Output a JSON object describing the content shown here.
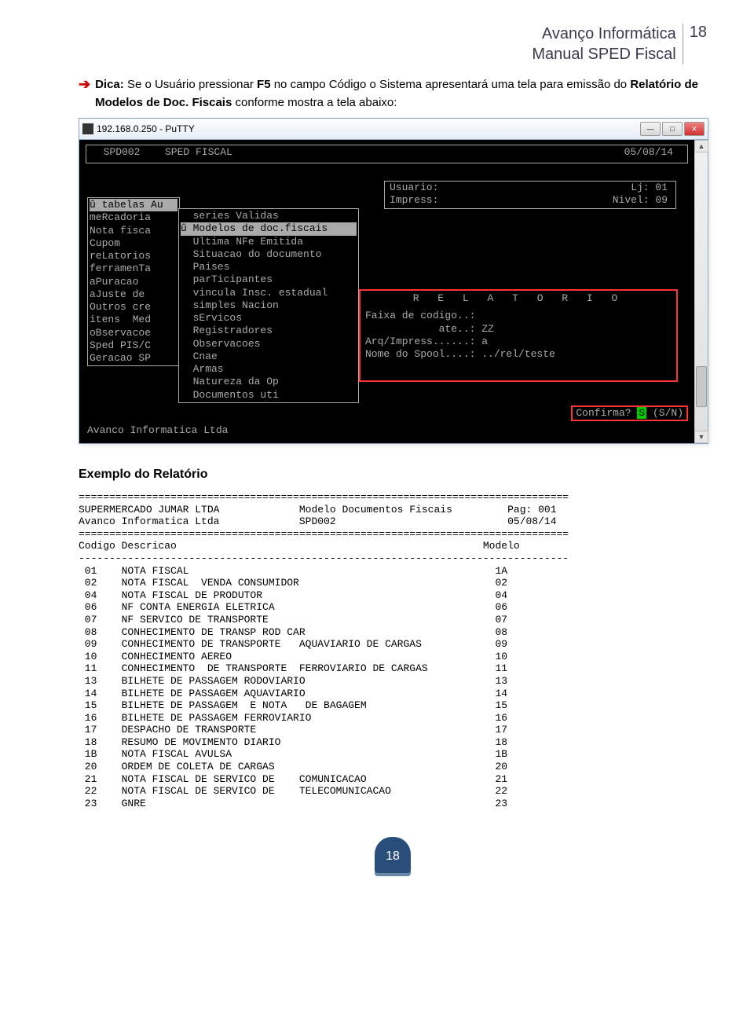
{
  "header": {
    "brand": "Avanço Informática",
    "manual": "Manual SPED Fiscal",
    "page": "18"
  },
  "dica": {
    "label": "Dica:",
    "text_before": " Se o Usuário pressionar ",
    "f5": "F5",
    "text_after": " no campo Código o Sistema apresentará uma tela para emissão do ",
    "bold2": "Relatório de Modelos de Doc. Fiscais",
    "text_end": " conforme mostra a tela abaixo:"
  },
  "putty": {
    "title": "192.168.0.250 - PuTTY",
    "btn_min": "—",
    "btn_max": "□",
    "btn_close": "✕"
  },
  "terminal": {
    "top": {
      "code": "SPD002",
      "title": "SPED FISCAL",
      "date": "05/08/14"
    },
    "userbox": {
      "l1a": "Usuario:",
      "l1b": "Lj: 01",
      "l2a": "Impress:",
      "l2b": "Nivel: 09"
    },
    "menu1": [
      "û tabelas Au",
      "meRcadoria",
      "Nota fisca",
      "Cupom",
      "reLatorios",
      "ferramenTa",
      "aPuracao",
      "aJuste de",
      "Outros cre",
      "itens  Med",
      "oBservacoe",
      "Sped PIS/C",
      "Geracao SP"
    ],
    "menu1_hl_index": 0,
    "menu2": [
      "  series Validas",
      "û Modelos de doc.fiscais",
      "  Ultima NFe Emitida",
      "  Situacao do documento",
      "  Paises",
      "  parTicipantes",
      "  vincula Insc. estadual",
      "  simples Nacion",
      "  sErvicos",
      "  Registradores",
      "  Observacoes",
      "  Cnae",
      "  Armas",
      "  Natureza da Op",
      "  Documentos uti"
    ],
    "menu2_hl_index": 1,
    "relatorio": {
      "title": "R E L A T O R I O",
      "lines": [
        "Faixa de codigo..:",
        "            ate..: ZZ",
        "Arq/Impress......: a",
        "Nome do Spool....: ../rel/teste"
      ]
    },
    "confirm": {
      "label": "Confirma? ",
      "val": "S",
      "opts": " (S/N)"
    },
    "footer": "Avanco Informatica Ltda"
  },
  "example_title": "Exemplo do Relatório",
  "report": {
    "sep": "================================================================================",
    "h1l": "SUPERMERCADO JUMAR LTDA",
    "h1m": "Modelo Documentos Fiscais",
    "h1r": "Pag: 001",
    "h2l": "Avanco Informatica Ltda",
    "h2m": "SPD002",
    "h2r": "05/08/14",
    "colhead_l": "Codigo Descricao",
    "colhead_r": "Modelo",
    "dash": "--------------------------------------------------------------------------------",
    "rows": [
      {
        "c": "01",
        "d": "NOTA FISCAL",
        "m": "1A"
      },
      {
        "c": "02",
        "d": "NOTA FISCAL  VENDA CONSUMIDOR",
        "m": "02"
      },
      {
        "c": "04",
        "d": "NOTA FISCAL DE PRODUTOR",
        "m": "04"
      },
      {
        "c": "06",
        "d": "NF CONTA ENERGIA ELETRICA",
        "m": "06"
      },
      {
        "c": "07",
        "d": "NF SERVICO DE TRANSPORTE",
        "m": "07"
      },
      {
        "c": "08",
        "d": "CONHECIMENTO DE TRANSP ROD CAR",
        "m": "08"
      },
      {
        "c": "09",
        "d": "CONHECIMENTO DE TRANSPORTE   AQUAVIARIO DE CARGAS",
        "m": "09"
      },
      {
        "c": "10",
        "d": "CONHECIMENTO AEREO",
        "m": "10"
      },
      {
        "c": "11",
        "d": "CONHECIMENTO  DE TRANSPORTE  FERROVIARIO DE CARGAS",
        "m": "11"
      },
      {
        "c": "13",
        "d": "BILHETE DE PASSAGEM RODOVIARIO",
        "m": "13"
      },
      {
        "c": "14",
        "d": "BILHETE DE PASSAGEM AQUAVIARIO",
        "m": "14"
      },
      {
        "c": "15",
        "d": "BILHETE DE PASSAGEM  E NOTA   DE BAGAGEM",
        "m": "15"
      },
      {
        "c": "16",
        "d": "BILHETE DE PASSAGEM FERROVIARIO",
        "m": "16"
      },
      {
        "c": "17",
        "d": "DESPACHO DE TRANSPORTE",
        "m": "17"
      },
      {
        "c": "18",
        "d": "RESUMO DE MOVIMENTO DIARIO",
        "m": "18"
      },
      {
        "c": "1B",
        "d": "NOTA FISCAL AVULSA",
        "m": "1B"
      },
      {
        "c": "20",
        "d": "ORDEM DE COLETA DE CARGAS",
        "m": "20"
      },
      {
        "c": "21",
        "d": "NOTA FISCAL DE SERVICO DE    COMUNICACAO",
        "m": "21"
      },
      {
        "c": "22",
        "d": "NOTA FISCAL DE SERVICO DE    TELECOMUNICACAO",
        "m": "22"
      },
      {
        "c": "23",
        "d": "GNRE",
        "m": "23"
      }
    ]
  },
  "footer_page": "18"
}
